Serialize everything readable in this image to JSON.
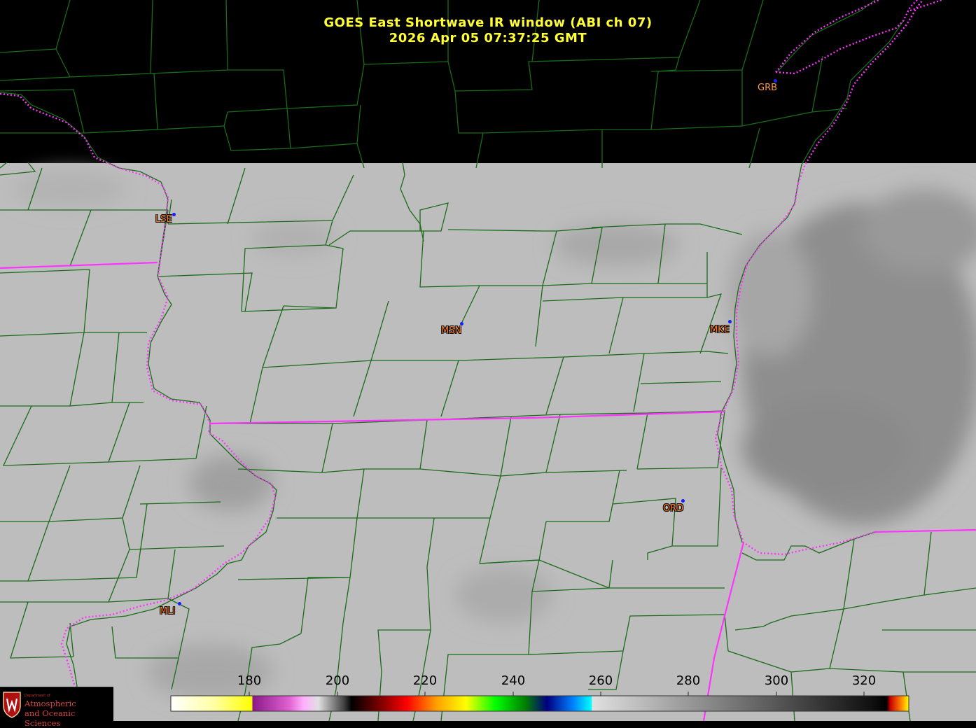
{
  "title": {
    "line1": "GOES East Shortwave IR window (ABI ch 07)",
    "line2": "2026 Apr 05  07:37:25 GMT"
  },
  "stations": [
    {
      "id": "GRB"
    },
    {
      "id": "LSE"
    },
    {
      "id": "MSN"
    },
    {
      "id": "MKE"
    },
    {
      "id": "ORD"
    },
    {
      "id": "MLI"
    }
  ],
  "colorbar": {
    "ticks": [
      "180",
      "200",
      "220",
      "240",
      "260",
      "280",
      "300",
      "320"
    ]
  },
  "logo": {
    "dept": "Department of",
    "line1": "Atmospheric",
    "line2": "and Oceanic Sciences"
  },
  "colors": {
    "title": "#ffff33",
    "station_label": "#ff7f1e",
    "county_lines": "#1a6b1a",
    "state_lines": "#ff33ff",
    "cloud_gray": "#bdbdbd"
  }
}
